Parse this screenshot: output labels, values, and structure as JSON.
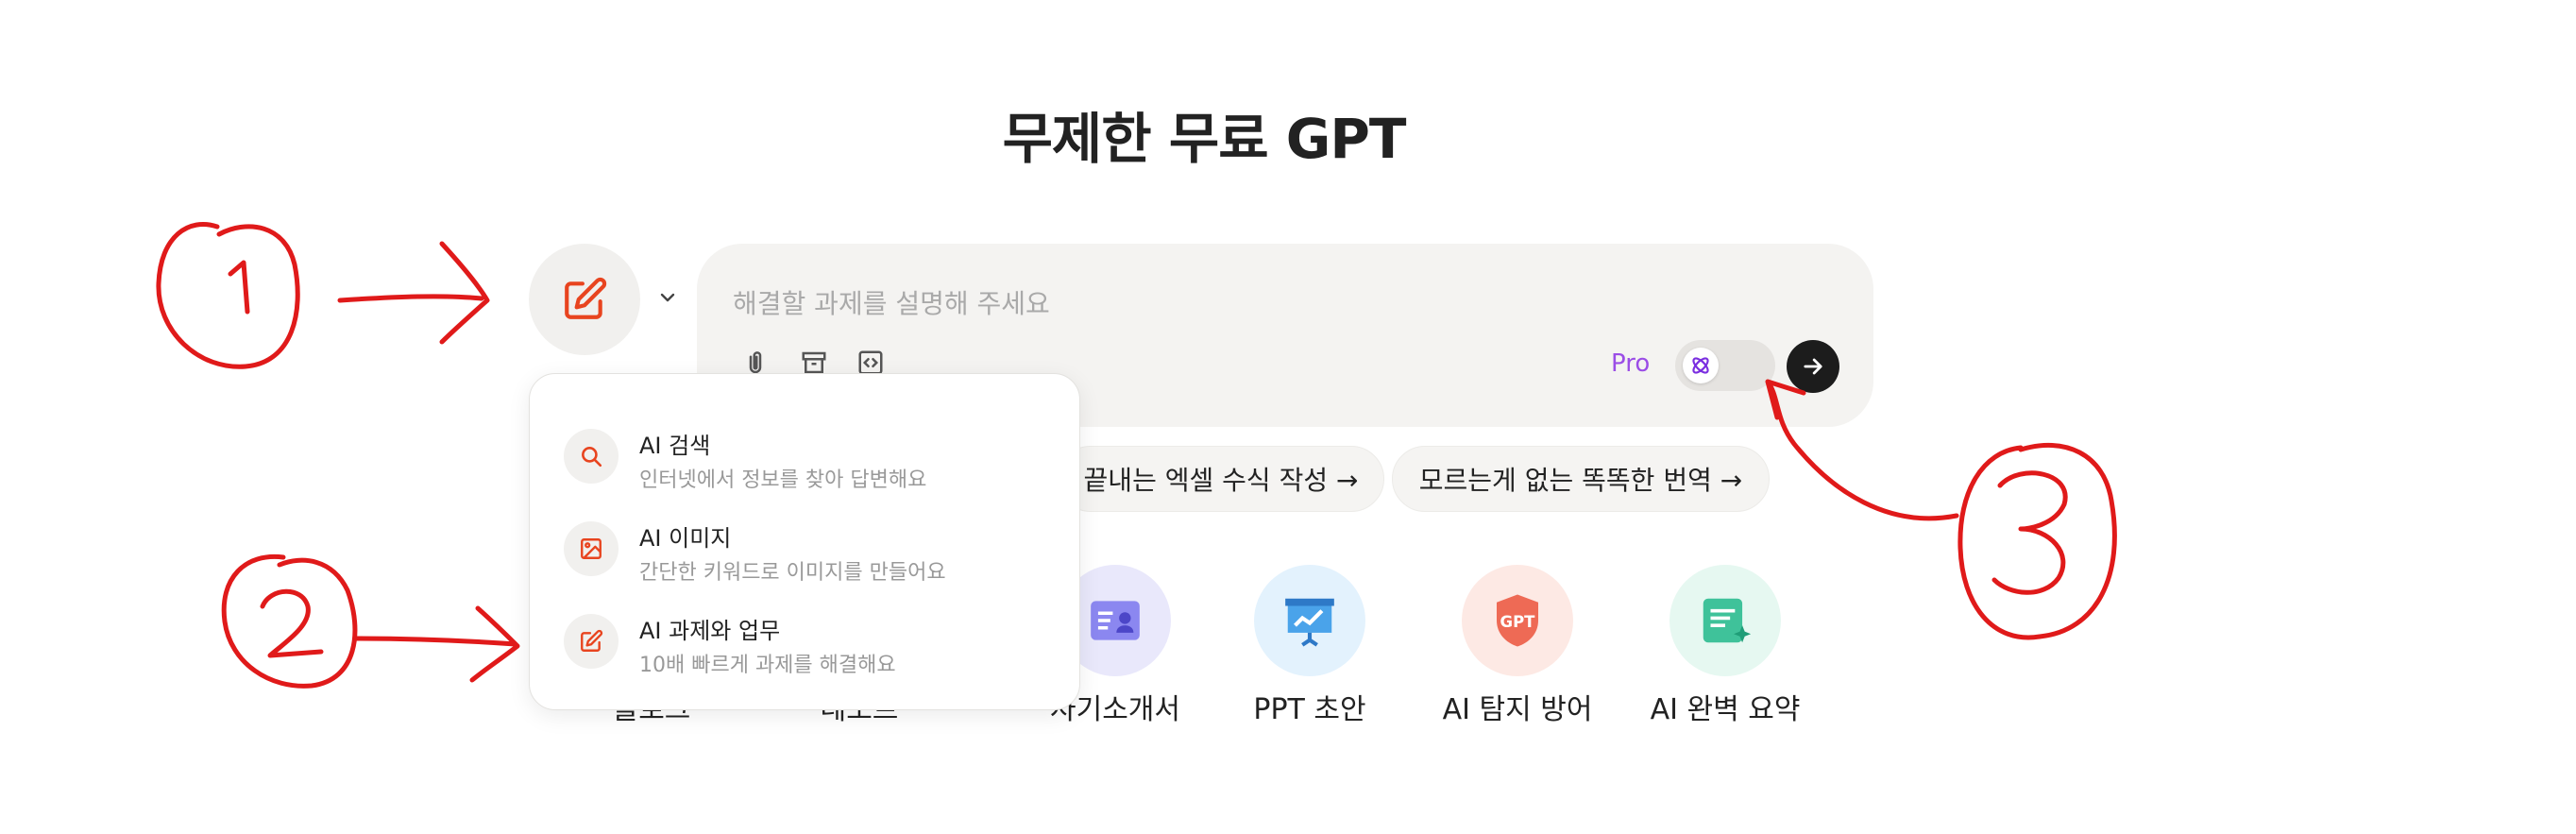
{
  "page": {
    "title": "무제한 무료 GPT"
  },
  "composer": {
    "placeholder": "해결할 과제를 설명해 주세요",
    "pro_label": "Pro"
  },
  "suggestions": [
    {
      "label": "끝내는 엑셀 수식 작성 →"
    },
    {
      "label": "모르는게 없는 똑똑한 번역 →"
    }
  ],
  "tiles": [
    {
      "label": "자기소개서",
      "icon": "resume-icon",
      "color": "#e9e8fb"
    },
    {
      "label": "PPT 초안",
      "icon": "presentation-icon",
      "color": "#e3f2fd"
    },
    {
      "label": "AI 탐지 방어",
      "icon": "shield-gpt-icon",
      "color": "#fde9e4"
    },
    {
      "label": "AI 완벽 요약",
      "icon": "summary-icon",
      "color": "#e6f8f1"
    }
  ],
  "tile_partial_labels": [
    "블로그",
    "레포트"
  ],
  "dropdown": {
    "items": [
      {
        "title": "AI 검색",
        "desc": "인터넷에서 정보를 찾아 답변해요",
        "icon": "search-icon"
      },
      {
        "title": "AI 이미지",
        "desc": "간단한 키워드로 이미지를 만들어요",
        "icon": "image-icon"
      },
      {
        "title": "AI 과제와 업무",
        "desc": "10배 빠르게 과제를 해결해요",
        "icon": "edit-icon"
      }
    ]
  },
  "shield_text": "GPT",
  "colors": {
    "accent": "#e8441f",
    "pro": "#9b4de6",
    "annotation": "#e01a1a"
  },
  "annotations": [
    "1",
    "2",
    "3"
  ]
}
